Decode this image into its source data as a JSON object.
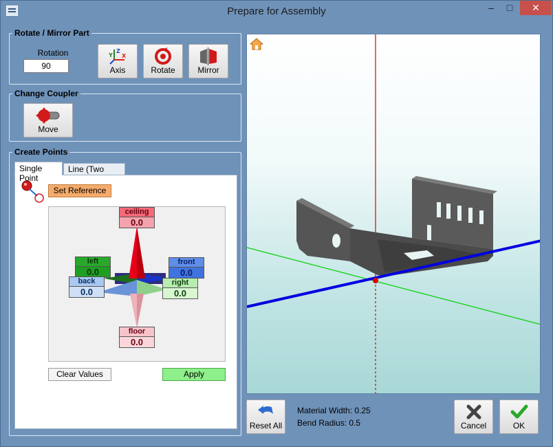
{
  "window": {
    "title": "Prepare for Assembly"
  },
  "rotate_group": {
    "legend": "Rotate / Mirror Part",
    "rotation_label": "Rotation Amount:",
    "rotation_value": "90",
    "axis_label": "Axis",
    "rotate_label": "Rotate",
    "mirror_label": "Mirror"
  },
  "coupler_group": {
    "legend": "Change Coupler",
    "move_label": "Move"
  },
  "points_group": {
    "legend": "Create Points",
    "tabs": [
      "Single Point",
      "Line (Two Points)"
    ],
    "set_reference_label": "Set Reference",
    "directions": {
      "ceiling": {
        "label": "ceiling",
        "value": "0.0"
      },
      "left": {
        "label": "left",
        "value": "0.0"
      },
      "front": {
        "label": "front",
        "value": "0.0"
      },
      "back": {
        "label": "back",
        "value": "0.0"
      },
      "right": {
        "label": "right",
        "value": "0.0"
      },
      "floor": {
        "label": "floor",
        "value": "0.0"
      }
    },
    "clear_label": "Clear Values",
    "apply_label": "Apply"
  },
  "footer": {
    "reset_label": "Reset All",
    "material_width": "Material Width: 0.25",
    "bend_radius": "Bend Radius: 0.5",
    "cancel_label": "Cancel",
    "ok_label": "OK"
  },
  "colors": {
    "ceiling": "#e8001a",
    "floor": "#f3b5bd",
    "left": "#1f9e22",
    "right": "#a8e8a0",
    "front": "#2f5fd8",
    "back": "#7fb0ea",
    "apply": "#8ef08a",
    "set_reference": "#f5ab6b",
    "x_axis": "#0000e0",
    "y_axis": "#e00000",
    "z_axis": "#00d000"
  }
}
